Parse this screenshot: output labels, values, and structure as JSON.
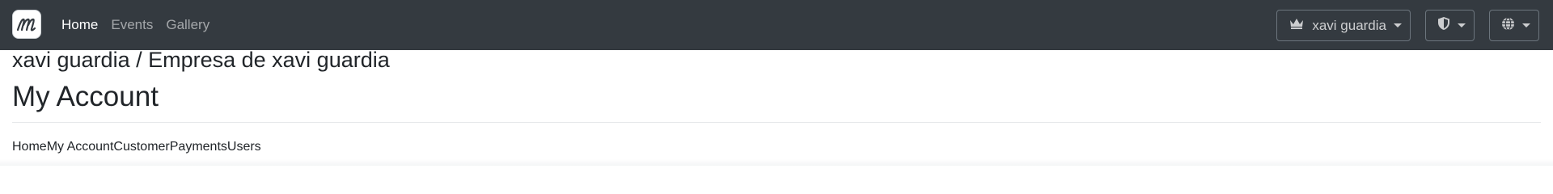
{
  "navbar": {
    "logo_icon": "logo-icon",
    "links": [
      {
        "label": "Home",
        "active": true
      },
      {
        "label": "Events",
        "active": false
      },
      {
        "label": "Gallery",
        "active": false
      }
    ],
    "user_menu": {
      "label": "xavi guardia",
      "icon": "crown-icon"
    },
    "security_menu": {
      "icon": "shield-icon"
    },
    "language_menu": {
      "icon": "globe-icon"
    }
  },
  "header": {
    "company": "xavi guardia / Empresa de xavi guardia",
    "title": "My Account"
  },
  "tabs": [
    "Home",
    "My Account",
    "Customer",
    "Payments",
    "Users"
  ],
  "colors": {
    "navbar_bg": "#343a40",
    "active_link": "#ffffff",
    "muted_link": "rgba(255,255,255,0.55)"
  }
}
